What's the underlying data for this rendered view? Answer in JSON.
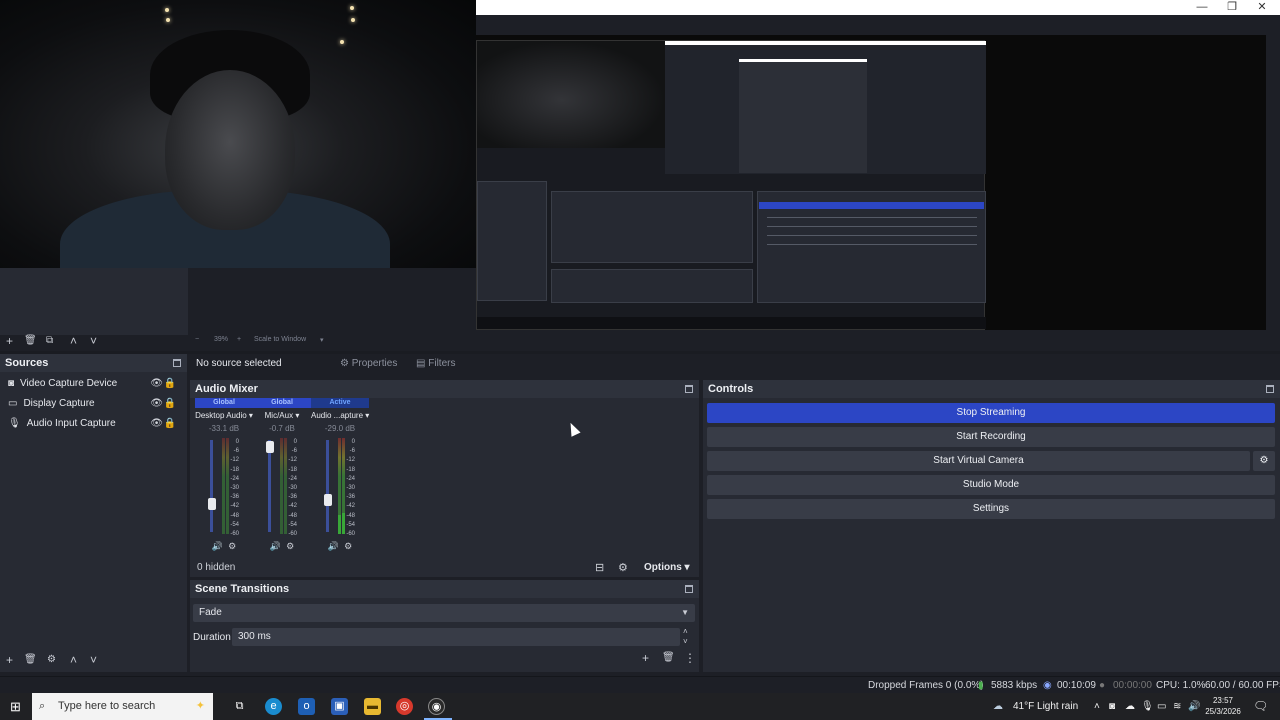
{
  "window": {
    "minimize_glyph": "—",
    "restore_glyph": "❐",
    "close_glyph": "✕"
  },
  "preview_toolbar": {
    "zoom_out": "−",
    "zoom_level": "39%",
    "zoom_in": "+",
    "scale_mode": "Scale to Window"
  },
  "scenes_toolbar": [
    "+",
    "🗑",
    "⧉",
    "˄",
    "˅"
  ],
  "sources": {
    "title": "Sources",
    "items": [
      {
        "label": "Video Capture Device",
        "icon": "camera-icon"
      },
      {
        "label": "Display Capture",
        "icon": "monitor-icon"
      },
      {
        "label": "Audio Input Capture",
        "icon": "microphone-icon"
      }
    ],
    "toolbar": [
      "+",
      "🗑",
      "⚙",
      "˄",
      "˅"
    ]
  },
  "context_bar": {
    "no_source": "No source selected",
    "properties": "Properties",
    "filters": "Filters"
  },
  "audio_mixer": {
    "title": "Audio Mixer",
    "channels": [
      {
        "tag": "Global",
        "name": "Desktop Audio",
        "db": "-33.1 dB",
        "level": 0.28
      },
      {
        "tag": "Global",
        "name": "Mic/Aux",
        "db": "-0.7 dB",
        "level": 0.99
      },
      {
        "tag": "Active",
        "name": "Audio ...apture",
        "db": "-29.0 dB",
        "level": 0.33
      }
    ],
    "scale": [
      "0",
      "-6",
      "-12",
      "-18",
      "-24",
      "-30",
      "-36",
      "-42",
      "-48",
      "-54",
      "-60"
    ],
    "hidden_count": "0 hidden",
    "options": "Options"
  },
  "controls": {
    "title": "Controls",
    "buttons": [
      "Stop Streaming",
      "Start Recording",
      "Start Virtual Camera",
      "Studio Mode",
      "Settings"
    ]
  },
  "scene_transitions": {
    "title": "Scene Transitions",
    "transition": "Fade",
    "duration_label": "Duration",
    "duration_value": "300 ms"
  },
  "status": {
    "dropped_frames": "Dropped Frames 0 (0.0%)",
    "bitrate": "5883 kbps",
    "stream_time": "00:10:09",
    "rec_time": "00:00:00",
    "cpu": "CPU: 1.0%",
    "fps": "60.00 / 60.00 FPS"
  },
  "taskbar": {
    "search_placeholder": "Type here to search",
    "weather": "41°F  Light rain",
    "time": "23:57",
    "date": "25/3/2026"
  },
  "colors": {
    "accent": "#2c46c5",
    "panel": "#272a33",
    "background": "#1d1f26"
  }
}
